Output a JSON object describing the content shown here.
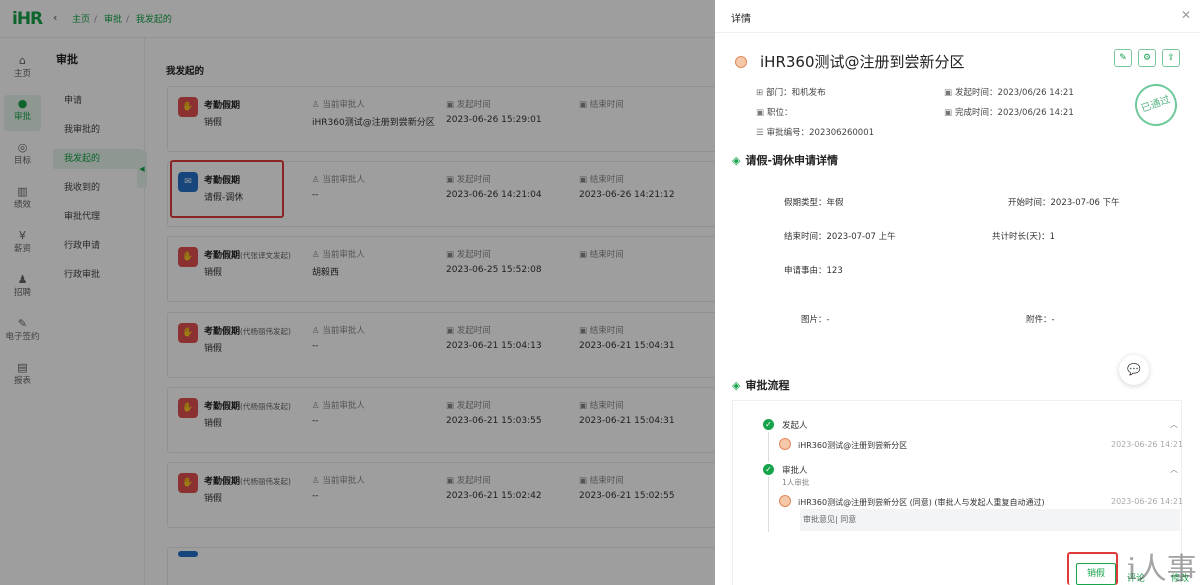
{
  "header": {
    "logo": "iHR",
    "back_icon": "chevron-left-icon",
    "breadcrumb": [
      "主页",
      "审批",
      "我发起的"
    ]
  },
  "sidebar": {
    "items": [
      {
        "label": "主页",
        "icon": "home-icon"
      },
      {
        "label": "审批",
        "icon": "user-icon",
        "active": true
      },
      {
        "label": "目标",
        "icon": "target-icon"
      },
      {
        "label": "绩效",
        "icon": "chart-icon"
      },
      {
        "label": "薪资",
        "icon": "money-icon"
      },
      {
        "label": "招聘",
        "icon": "recruit-icon"
      },
      {
        "label": "电子签约",
        "icon": "sign-icon"
      },
      {
        "label": "报表",
        "icon": "report-icon"
      }
    ]
  },
  "subnav": {
    "title": "审批",
    "items": [
      "申请",
      "我审批的",
      "我发起的",
      "我收到的",
      "审批代理",
      "行政申请",
      "行政审批"
    ],
    "active_index": 2
  },
  "main": {
    "title": "我发起的",
    "col_labels": {
      "approver": "当前审批人",
      "start": "发起时间",
      "end": "结束时间"
    },
    "cards": [
      {
        "name": "考勤假期",
        "tag": "",
        "type": "销假",
        "approver": "iHR360测试@注册到尝新分区",
        "start": "2023-06-26 15:29:01",
        "end": "",
        "badge": "red"
      },
      {
        "name": "考勤假期",
        "tag": "",
        "type": "请假-调休",
        "approver": "--",
        "start": "2023-06-26 14:21:04",
        "end": "2023-06-26 14:21:12",
        "badge": "blue"
      },
      {
        "name": "考勤假期",
        "tag": "(代张译文发起)",
        "type": "销假",
        "approver": "胡毅西",
        "start": "2023-06-25 15:52:08",
        "end": "",
        "badge": "red"
      },
      {
        "name": "考勤假期",
        "tag": "(代杨丽伟发起)",
        "type": "销假",
        "approver": "--",
        "start": "2023-06-21 15:04:13",
        "end": "2023-06-21 15:04:31",
        "badge": "red"
      },
      {
        "name": "考勤假期",
        "tag": "(代杨丽伟发起)",
        "type": "销假",
        "approver": "--",
        "start": "2023-06-21 15:03:55",
        "end": "2023-06-21 15:04:31",
        "badge": "red"
      },
      {
        "name": "考勤假期",
        "tag": "(代杨丽伟发起)",
        "type": "销假",
        "approver": "--",
        "start": "2023-06-21 15:02:42",
        "end": "2023-06-21 15:02:55",
        "badge": "red"
      }
    ]
  },
  "drawer": {
    "header": "详情",
    "title": "iHR360测试@注册到尝新分区",
    "meta": {
      "dept_label": "部门：",
      "dept": "和机发布",
      "post_label": "职位：",
      "post": "",
      "serial_label": "审批编号：",
      "serial": "202306260001",
      "created_label": "发起时间：",
      "created": "2023/06/26 14:21",
      "done_label": "完成时间：",
      "done": "2023/06/26 14:21"
    },
    "stamp": "已通过",
    "detail_section": "请假-调休申请详情",
    "fields": {
      "leave_type": "假期类型：年假",
      "start": "开始时间：2023-07-06 下午",
      "end": "结束时间：2023-07-07 上午",
      "duration": "共计时长(天)：1",
      "reason": "申请事由：123",
      "images": "图片：-",
      "attachments": "附件：-"
    },
    "flow_section": "审批流程",
    "flow": {
      "initiator_label": "发起人",
      "initiator_name": "iHR360测试@注册到尝新分区",
      "initiator_time": "2023-06-26 14:21",
      "approver_label": "审批人",
      "approver_count": "1人审批",
      "approver_name": "iHR360测试@注册到尝新分区 (同意) (审批人与发起人重复自动通过)",
      "approver_time": "2023-06-26 14:21",
      "opinion": "审批意见| 同意"
    },
    "actions": {
      "cancel": "销假",
      "comment": "评论",
      "modify": "修改"
    },
    "watermark": "i人事"
  }
}
